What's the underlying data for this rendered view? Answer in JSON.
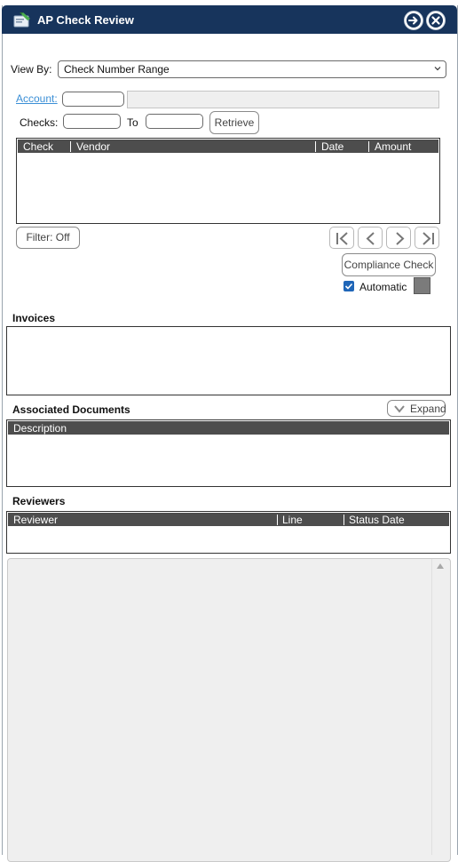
{
  "window": {
    "title": "AP Check Review"
  },
  "view_by": {
    "label": "View By:",
    "selected": "Check Number Range"
  },
  "account": {
    "label": "Account:",
    "value": "",
    "description": ""
  },
  "checks": {
    "label": "Checks:",
    "from_value": "",
    "to_label": "To",
    "to_value": "",
    "retrieve_label": "Retrieve"
  },
  "check_grid": {
    "columns": [
      "Check",
      "Vendor",
      "Date",
      "Amount"
    ],
    "rows": []
  },
  "filter": {
    "label": "Filter: Off"
  },
  "compliance": {
    "button_label": "Compliance Check",
    "automatic_label": "Automatic",
    "automatic_checked": true
  },
  "invoices": {
    "title": "Invoices"
  },
  "associated_documents": {
    "title": "Associated Documents",
    "expand_label": "Expand",
    "columns": [
      "Description"
    ]
  },
  "reviewers": {
    "title": "Reviewers",
    "columns": [
      "Reviewer",
      "Line",
      "Status Date"
    ]
  },
  "icons": {
    "app": "check-review-icon",
    "forward": "arrow-right-circle-icon",
    "close": "close-circle-icon",
    "first": "first-page-icon",
    "prev": "previous-icon",
    "next": "next-icon",
    "last": "last-page-icon",
    "expand": "chevron-down-icon",
    "scroll_up": "scroll-up-arrow-icon"
  },
  "colors": {
    "titlebar": "#17345c",
    "grid_header": "#4d4d4d",
    "link": "#3b8fd6",
    "checkbox": "#1f66b8"
  }
}
